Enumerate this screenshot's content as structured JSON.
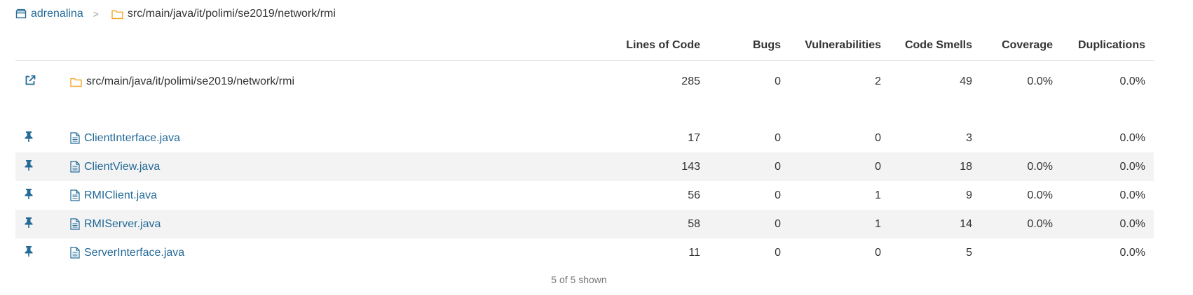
{
  "breadcrumb": {
    "project": "adrenalina",
    "separator": ">",
    "path": "src/main/java/it/polimi/se2019/network/rmi"
  },
  "table": {
    "headers": {
      "lines_of_code": "Lines of Code",
      "bugs": "Bugs",
      "vulnerabilities": "Vulnerabilities",
      "code_smells": "Code Smells",
      "coverage": "Coverage",
      "duplications": "Duplications"
    },
    "directory": {
      "name": "src/main/java/it/polimi/se2019/network/rmi",
      "lines_of_code": "285",
      "bugs": "0",
      "vulnerabilities": "2",
      "code_smells": "49",
      "coverage": "0.0%",
      "duplications": "0.0%"
    },
    "files": [
      {
        "name": "ClientInterface.java",
        "lines_of_code": "17",
        "bugs": "0",
        "vulnerabilities": "0",
        "code_smells": "3",
        "coverage": "",
        "duplications": "0.0%"
      },
      {
        "name": "ClientView.java",
        "lines_of_code": "143",
        "bugs": "0",
        "vulnerabilities": "0",
        "code_smells": "18",
        "coverage": "0.0%",
        "duplications": "0.0%"
      },
      {
        "name": "RMIClient.java",
        "lines_of_code": "56",
        "bugs": "0",
        "vulnerabilities": "1",
        "code_smells": "9",
        "coverage": "0.0%",
        "duplications": "0.0%"
      },
      {
        "name": "RMIServer.java",
        "lines_of_code": "58",
        "bugs": "0",
        "vulnerabilities": "1",
        "code_smells": "14",
        "coverage": "0.0%",
        "duplications": "0.0%"
      },
      {
        "name": "ServerInterface.java",
        "lines_of_code": "11",
        "bugs": "0",
        "vulnerabilities": "0",
        "code_smells": "5",
        "coverage": "",
        "duplications": "0.0%"
      }
    ]
  },
  "footer": {
    "shown": "5 of 5 shown"
  },
  "icons": {
    "project": "project-icon",
    "folder": "folder-icon",
    "open_component": "external-link-icon",
    "pin": "pin-icon",
    "file": "file-icon"
  },
  "colors": {
    "link": "#236a97",
    "folder": "#f0a82c",
    "row_alt": "#f3f3f3",
    "border": "#e6e6e6"
  }
}
